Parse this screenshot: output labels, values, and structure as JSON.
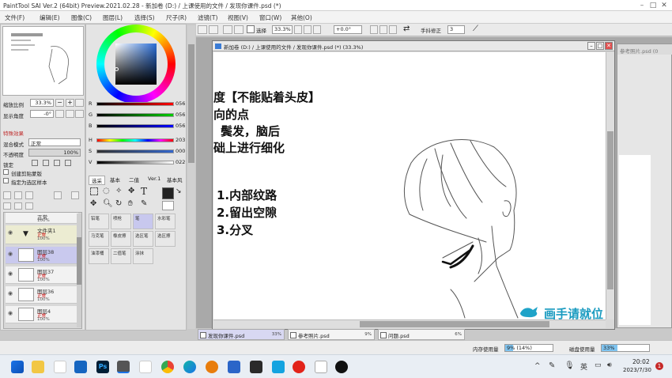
{
  "window": {
    "title": "PaintTool SAI Ver.2 (64bit) Preview.2021.02.28 - 新加卷 (D:) / 上课使用的文件 / 发现你课件.psd (*)",
    "controls": [
      "–",
      "□",
      "✕"
    ]
  },
  "menu": [
    "文件(F)",
    "编辑(E)",
    "图像(C)",
    "图层(L)",
    "选择(S)",
    "尺子(R)",
    "滤镜(T)",
    "视图(V)",
    "窗口(W)",
    "其他(O)"
  ],
  "navigator": {
    "zoom_label": "缩放比例",
    "zoom_value": "33.3%",
    "angle_label": "显示角度",
    "angle_value": "-0°"
  },
  "effects": {
    "header": "特殊效果",
    "blend_label": "混合模式",
    "blend_value": "正常",
    "opacity_label": "不透明度",
    "opacity_value": "100%",
    "lock_label": "锁定",
    "clip_label": "创建剪贴蒙版",
    "select_label": "指定为选区样本"
  },
  "layers": [
    {
      "name": "图层",
      "mode": "正常",
      "opacity": "100%"
    },
    {
      "name": "文件夹1",
      "mode": "正常",
      "opacity": "100%"
    },
    {
      "name": "图层38",
      "mode": "正常",
      "opacity": "100%"
    },
    {
      "name": "图层37",
      "mode": "正常",
      "opacity": "100%"
    },
    {
      "name": "图层36",
      "mode": "正常",
      "opacity": "100%"
    },
    {
      "name": "图层4",
      "mode": "正常",
      "opacity": "100%"
    }
  ],
  "color_sliders": [
    {
      "label": "R",
      "value": "056",
      "color": "#d23030"
    },
    {
      "label": "G",
      "value": "056",
      "color": "#30a030"
    },
    {
      "label": "B",
      "value": "056",
      "color": "#3040d0"
    },
    {
      "label": "H",
      "value": "203",
      "color": "#888"
    },
    {
      "label": "S",
      "value": "000",
      "color": "#888"
    },
    {
      "label": "V",
      "value": "022",
      "color": "#888"
    }
  ],
  "brush_tabs": [
    "选采",
    "基本",
    "二值",
    "Ver.1",
    "基本风"
  ],
  "tools": [
    {
      "name": "铅笔"
    },
    {
      "name": "喷枪"
    },
    {
      "name": "笔"
    },
    {
      "name": "水彩笔"
    },
    {
      "name": "马克笔"
    },
    {
      "name": "橡皮擦"
    },
    {
      "name": "选区笔"
    },
    {
      "name": "选区擦"
    },
    {
      "name": "油漆桶"
    },
    {
      "name": "二值笔"
    },
    {
      "name": "涂抹"
    },
    {
      "name": ""
    }
  ],
  "toolbar": {
    "select_label": "选择",
    "zoom_value": "33.3%",
    "angle_value": "+0.0°",
    "stabilizer_label": "手抖修正",
    "stabilizer_value": "3"
  },
  "doc_window": {
    "title": "新加卷 (D:) / 上课使用的文件 / 发现你课件.psd (*) (33.3%)"
  },
  "bg_doc_title": "参考照片.psd (0",
  "canvas_text": {
    "line1": "度【不能贴着头皮】",
    "line2": "向的点",
    "line3": "，鬓发，脑后",
    "line4": "础上进行细化",
    "item1": "1.内部纹路",
    "item2": "2.留出空隙",
    "item3": "3.分叉"
  },
  "watermark": "画手请就位",
  "doc_tabs": [
    {
      "name": "发现你课件.psd",
      "pct": "33%"
    },
    {
      "name": "参考照片.psd",
      "pct": "9%"
    },
    {
      "name": "问题.psd",
      "pct": "6%"
    }
  ],
  "status": {
    "mem_label": "内存使用量",
    "mem_value": "9% (14%)",
    "disk_label": "磁盘使用量",
    "disk_value": "33%"
  },
  "taskbar": {
    "lang": "英",
    "time": "20:02",
    "date": "2023/7/30",
    "badge": "1"
  }
}
